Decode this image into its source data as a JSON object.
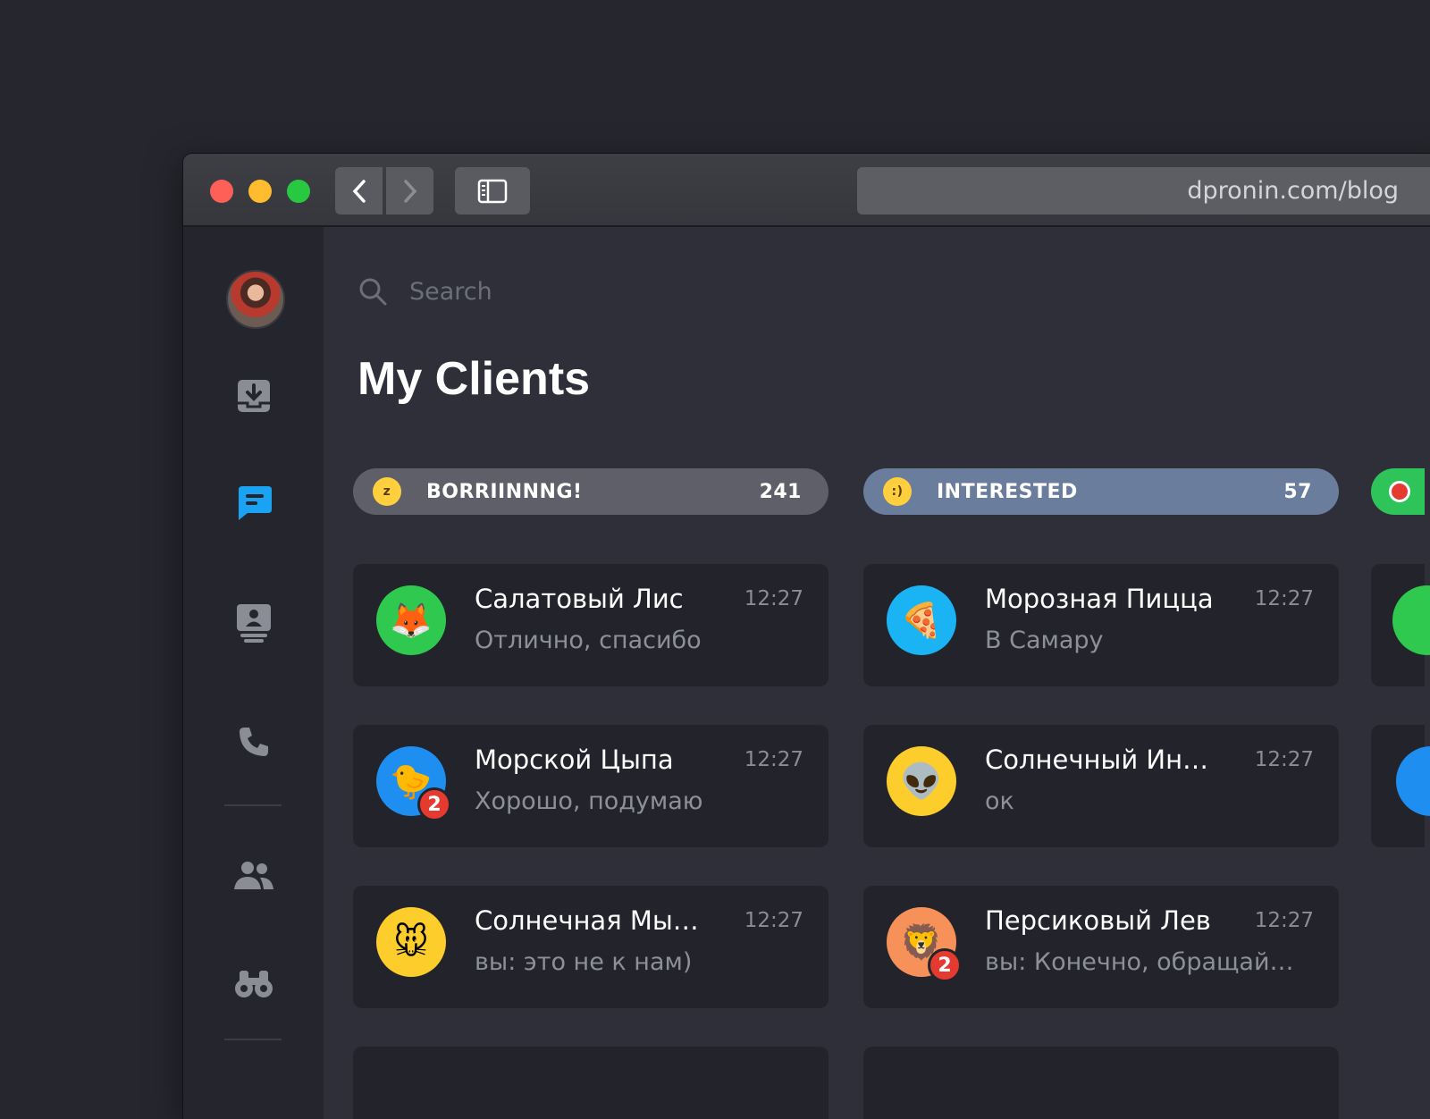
{
  "browser": {
    "url": "dpronin.com/blog"
  },
  "search": {
    "placeholder": "Search"
  },
  "page": {
    "title": "My Clients"
  },
  "columns": [
    {
      "label": "BORRIINNNG!",
      "count": "241",
      "header_color": "#5e5f69",
      "cards": [
        {
          "name": "Салатовый Лис",
          "time": "12:27",
          "message": "Отлично, спасибо",
          "avatar_icon": "fox-icon",
          "avatar_bg": "#2fc94f",
          "badge": ""
        },
        {
          "name": "Морской Цыпа",
          "time": "12:27",
          "message": "Хорошо, подумаю",
          "avatar_icon": "chick-icon",
          "avatar_bg": "#1e8ef0",
          "badge": "2"
        },
        {
          "name": "Солнечная Мышь",
          "time": "12:27",
          "message": "вы: это не к нам)",
          "avatar_icon": "mouse-icon",
          "avatar_bg": "#fdcd2b",
          "badge": ""
        }
      ]
    },
    {
      "label": "INTERESTED",
      "count": "57",
      "header_color": "#6b7d9c",
      "cards": [
        {
          "name": "Морозная Пицца",
          "time": "12:27",
          "message": "В Самару",
          "avatar_icon": "pizza-icon",
          "avatar_bg": "#1ab4f5",
          "badge": ""
        },
        {
          "name": "Солнечный Иноп...",
          "time": "12:27",
          "message": "ок",
          "avatar_icon": "alien-icon",
          "avatar_bg": "#fdcd2b",
          "badge": ""
        },
        {
          "name": "Персиковый Лев",
          "time": "12:27",
          "message": "вы: Конечно, обращайт...",
          "avatar_icon": "lion-icon",
          "avatar_bg": "#f7915a",
          "badge": "2"
        }
      ]
    }
  ],
  "colors": {
    "accent": "#1aa3f3",
    "third_column_header": "#2ec45a",
    "badge": "#e53a2f"
  }
}
